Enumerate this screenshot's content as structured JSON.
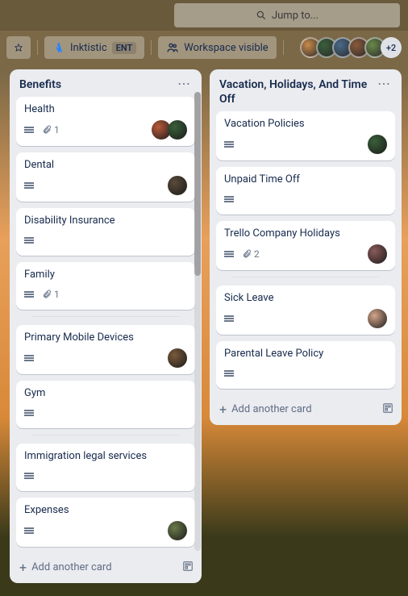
{
  "search": {
    "placeholder": "Jump to..."
  },
  "workspace": {
    "name": "Inktistic",
    "badge": "ENT",
    "visibility": "Workspace visible",
    "extra_members": "+2"
  },
  "avatar_colors": [
    "#c98b4a",
    "#3a5f3a",
    "#4a6a8a",
    "#8a5a3a",
    "#6a8a4a"
  ],
  "lists": [
    {
      "title": "Benefits",
      "add": "Add another card",
      "cards": [
        {
          "title": "Health",
          "desc": true,
          "attach": "1",
          "avatars": [
            "#b85a3a",
            "#3a5f3a"
          ]
        },
        {
          "title": "Dental",
          "desc": true,
          "avatars": [
            "#5a4a3a"
          ]
        },
        {
          "title": "Disability Insurance",
          "desc": true
        },
        {
          "title": "Family",
          "desc": true,
          "attach": "1"
        },
        {
          "sep": true
        },
        {
          "title": "Primary Mobile Devices",
          "desc": true,
          "avatars": [
            "#7a5a3a"
          ]
        },
        {
          "title": "Gym",
          "desc": true
        },
        {
          "sep": true
        },
        {
          "title": "Immigration legal services",
          "desc": true
        },
        {
          "title": "Expenses",
          "desc": true,
          "avatars": [
            "#6a7a4a"
          ]
        }
      ]
    },
    {
      "title": "Vacation, Holidays, And Time Off",
      "add": "Add another card",
      "cards": [
        {
          "title": "Vacation Policies",
          "desc": true,
          "avatars": [
            "#3a5f3a"
          ]
        },
        {
          "title": "Unpaid Time Off",
          "desc": true
        },
        {
          "title": "Trello Company Holidays",
          "desc": true,
          "attach": "2",
          "avatars": [
            "#8a5a5a"
          ]
        },
        {
          "sep": true
        },
        {
          "title": "Sick Leave",
          "desc": true,
          "avatars": [
            "#d4a58a"
          ]
        },
        {
          "title": "Parental Leave Policy",
          "desc": true
        }
      ]
    }
  ]
}
